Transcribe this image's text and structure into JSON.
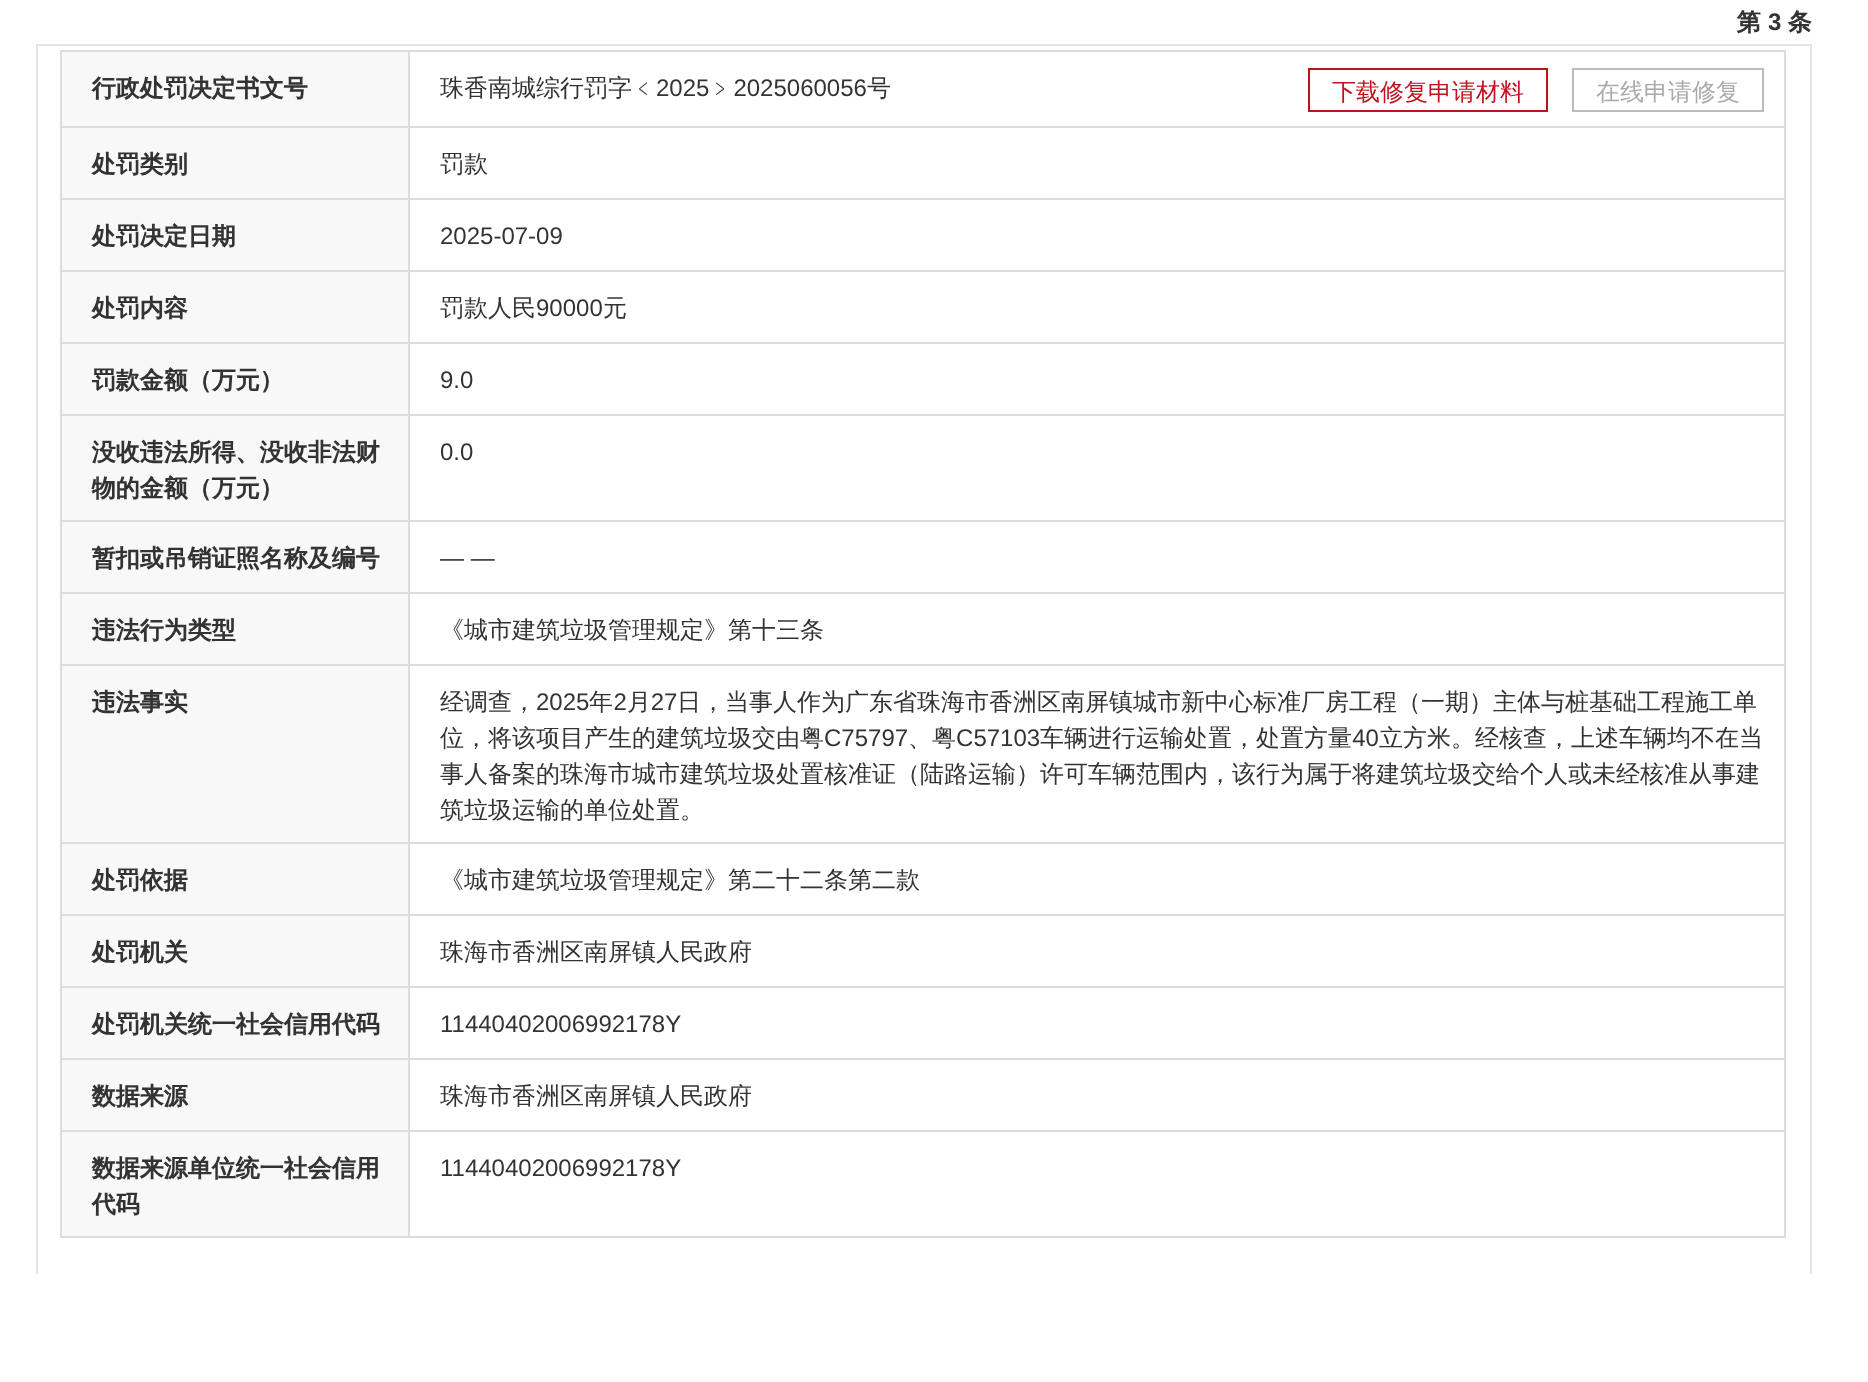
{
  "record_index": "第 3 条",
  "rows": [
    {
      "label": "行政处罚决定书文号",
      "value": "珠香南城综行罚字﹤2025﹥2025060056号",
      "buttons": [
        {
          "label": "下载修复申请材料",
          "disabled": false
        },
        {
          "label": "在线申请修复",
          "disabled": true
        }
      ]
    },
    {
      "label": "处罚类别",
      "value": "罚款"
    },
    {
      "label": "处罚决定日期",
      "value": "2025-07-09"
    },
    {
      "label": "处罚内容",
      "value": "罚款人民90000元"
    },
    {
      "label": "罚款金额（万元）",
      "value": "9.0"
    },
    {
      "label": "没收违法所得、没收非法财物的金额（万元）",
      "value": "0.0"
    },
    {
      "label": "暂扣或吊销证照名称及编号",
      "value": "— —"
    },
    {
      "label": "违法行为类型",
      "value": "《城市建筑垃圾管理规定》第十三条"
    },
    {
      "label": "违法事实",
      "value": "经调查，2025年2月27日，当事人作为广东省珠海市香洲区南屏镇城市新中心标准厂房工程（一期）主体与桩基础工程施工单位，将该项目产生的建筑垃圾交由粤C75797、粤C57103车辆进行运输处置，处置方量40立方米。经核查，上述车辆均不在当事人备案的珠海市城市建筑垃圾处置核准证（陆路运输）许可车辆范围内，该行为属于将建筑垃圾交给个人或未经核准从事建筑垃圾运输的单位处置。"
    },
    {
      "label": "处罚依据",
      "value": "《城市建筑垃圾管理规定》第二十二条第二款"
    },
    {
      "label": "处罚机关",
      "value": "珠海市香洲区南屏镇人民政府"
    },
    {
      "label": "处罚机关统一社会信用代码",
      "value": "11440402006992178Y"
    },
    {
      "label": "数据来源",
      "value": "珠海市香洲区南屏镇人民政府"
    },
    {
      "label": "数据来源单位统一社会信用代码",
      "value": "11440402006992178Y"
    }
  ]
}
